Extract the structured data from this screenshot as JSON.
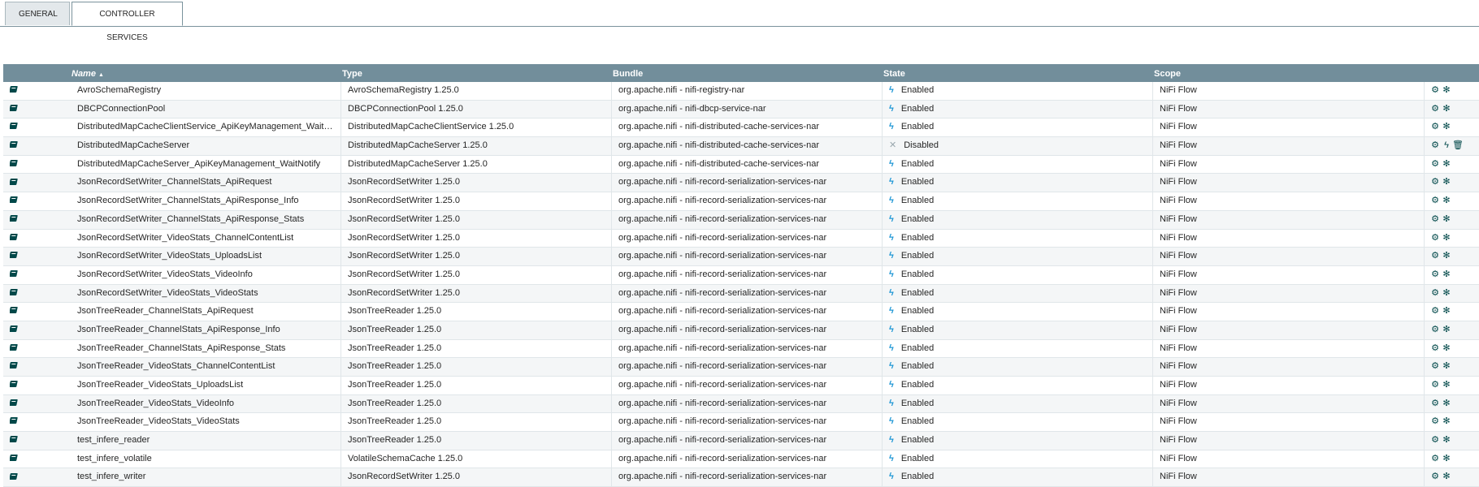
{
  "tabs": [
    {
      "label": "GENERAL"
    },
    {
      "label": "CONTROLLER SERVICES"
    }
  ],
  "table": {
    "columns": {
      "name": "Name",
      "sort_indicator": "▲",
      "type": "Type",
      "bundle": "Bundle",
      "state": "State",
      "scope": "Scope"
    },
    "rows": [
      {
        "name": "AvroSchemaRegistry",
        "type": "AvroSchemaRegistry 1.25.0",
        "bundle": "org.apache.nifi - nifi-registry-nar",
        "state": "Enabled",
        "scope": "NiFi Flow",
        "enabled": true
      },
      {
        "name": "DBCPConnectionPool",
        "type": "DBCPConnectionPool 1.25.0",
        "bundle": "org.apache.nifi - nifi-dbcp-service-nar",
        "state": "Enabled",
        "scope": "NiFi Flow",
        "enabled": true
      },
      {
        "name": "DistributedMapCacheClientService_ApiKeyManagement_WaitNotify",
        "type": "DistributedMapCacheClientService 1.25.0",
        "bundle": "org.apache.nifi - nifi-distributed-cache-services-nar",
        "state": "Enabled",
        "scope": "NiFi Flow",
        "enabled": true
      },
      {
        "name": "DistributedMapCacheServer",
        "type": "DistributedMapCacheServer 1.25.0",
        "bundle": "org.apache.nifi - nifi-distributed-cache-services-nar",
        "state": "Disabled",
        "scope": "NiFi Flow",
        "enabled": false
      },
      {
        "name": "DistributedMapCacheServer_ApiKeyManagement_WaitNotify",
        "type": "DistributedMapCacheServer 1.25.0",
        "bundle": "org.apache.nifi - nifi-distributed-cache-services-nar",
        "state": "Enabled",
        "scope": "NiFi Flow",
        "enabled": true
      },
      {
        "name": "JsonRecordSetWriter_ChannelStats_ApiRequest",
        "type": "JsonRecordSetWriter 1.25.0",
        "bundle": "org.apache.nifi - nifi-record-serialization-services-nar",
        "state": "Enabled",
        "scope": "NiFi Flow",
        "enabled": true
      },
      {
        "name": "JsonRecordSetWriter_ChannelStats_ApiResponse_Info",
        "type": "JsonRecordSetWriter 1.25.0",
        "bundle": "org.apache.nifi - nifi-record-serialization-services-nar",
        "state": "Enabled",
        "scope": "NiFi Flow",
        "enabled": true
      },
      {
        "name": "JsonRecordSetWriter_ChannelStats_ApiResponse_Stats",
        "type": "JsonRecordSetWriter 1.25.0",
        "bundle": "org.apache.nifi - nifi-record-serialization-services-nar",
        "state": "Enabled",
        "scope": "NiFi Flow",
        "enabled": true
      },
      {
        "name": "JsonRecordSetWriter_VideoStats_ChannelContentList",
        "type": "JsonRecordSetWriter 1.25.0",
        "bundle": "org.apache.nifi - nifi-record-serialization-services-nar",
        "state": "Enabled",
        "scope": "NiFi Flow",
        "enabled": true
      },
      {
        "name": "JsonRecordSetWriter_VideoStats_UploadsList",
        "type": "JsonRecordSetWriter 1.25.0",
        "bundle": "org.apache.nifi - nifi-record-serialization-services-nar",
        "state": "Enabled",
        "scope": "NiFi Flow",
        "enabled": true
      },
      {
        "name": "JsonRecordSetWriter_VideoStats_VideoInfo",
        "type": "JsonRecordSetWriter 1.25.0",
        "bundle": "org.apache.nifi - nifi-record-serialization-services-nar",
        "state": "Enabled",
        "scope": "NiFi Flow",
        "enabled": true
      },
      {
        "name": "JsonRecordSetWriter_VideoStats_VideoStats",
        "type": "JsonRecordSetWriter 1.25.0",
        "bundle": "org.apache.nifi - nifi-record-serialization-services-nar",
        "state": "Enabled",
        "scope": "NiFi Flow",
        "enabled": true
      },
      {
        "name": "JsonTreeReader_ChannelStats_ApiRequest",
        "type": "JsonTreeReader 1.25.0",
        "bundle": "org.apache.nifi - nifi-record-serialization-services-nar",
        "state": "Enabled",
        "scope": "NiFi Flow",
        "enabled": true
      },
      {
        "name": "JsonTreeReader_ChannelStats_ApiResponse_Info",
        "type": "JsonTreeReader 1.25.0",
        "bundle": "org.apache.nifi - nifi-record-serialization-services-nar",
        "state": "Enabled",
        "scope": "NiFi Flow",
        "enabled": true
      },
      {
        "name": "JsonTreeReader_ChannelStats_ApiResponse_Stats",
        "type": "JsonTreeReader 1.25.0",
        "bundle": "org.apache.nifi - nifi-record-serialization-services-nar",
        "state": "Enabled",
        "scope": "NiFi Flow",
        "enabled": true
      },
      {
        "name": "JsonTreeReader_VideoStats_ChannelContentList",
        "type": "JsonTreeReader 1.25.0",
        "bundle": "org.apache.nifi - nifi-record-serialization-services-nar",
        "state": "Enabled",
        "scope": "NiFi Flow",
        "enabled": true
      },
      {
        "name": "JsonTreeReader_VideoStats_UploadsList",
        "type": "JsonTreeReader 1.25.0",
        "bundle": "org.apache.nifi - nifi-record-serialization-services-nar",
        "state": "Enabled",
        "scope": "NiFi Flow",
        "enabled": true
      },
      {
        "name": "JsonTreeReader_VideoStats_VideoInfo",
        "type": "JsonTreeReader 1.25.0",
        "bundle": "org.apache.nifi - nifi-record-serialization-services-nar",
        "state": "Enabled",
        "scope": "NiFi Flow",
        "enabled": true
      },
      {
        "name": "JsonTreeReader_VideoStats_VideoStats",
        "type": "JsonTreeReader 1.25.0",
        "bundle": "org.apache.nifi - nifi-record-serialization-services-nar",
        "state": "Enabled",
        "scope": "NiFi Flow",
        "enabled": true
      },
      {
        "name": "test_infere_reader",
        "type": "JsonTreeReader 1.25.0",
        "bundle": "org.apache.nifi - nifi-record-serialization-services-nar",
        "state": "Enabled",
        "scope": "NiFi Flow",
        "enabled": true
      },
      {
        "name": "test_infere_volatile",
        "type": "VolatileSchemaCache 1.25.0",
        "bundle": "org.apache.nifi - nifi-record-serialization-services-nar",
        "state": "Enabled",
        "scope": "NiFi Flow",
        "enabled": true
      },
      {
        "name": "test_infere_writer",
        "type": "JsonRecordSetWriter 1.25.0",
        "bundle": "org.apache.nifi - nifi-record-serialization-services-nar",
        "state": "Enabled",
        "scope": "NiFi Flow",
        "enabled": true
      }
    ]
  },
  "icons": {
    "usage": "book-icon",
    "enabled": "bolt-icon",
    "disabled": "bolt-disabled-icon",
    "configure": "gear-icon",
    "enable": "bolt-icon",
    "disable": "disable-icon",
    "delete": "trash-icon"
  },
  "colors": {
    "header_bg": "#728e9b",
    "accent": "#004849",
    "enabled": "#1b95d4",
    "disabled": "#9aa8ae"
  }
}
